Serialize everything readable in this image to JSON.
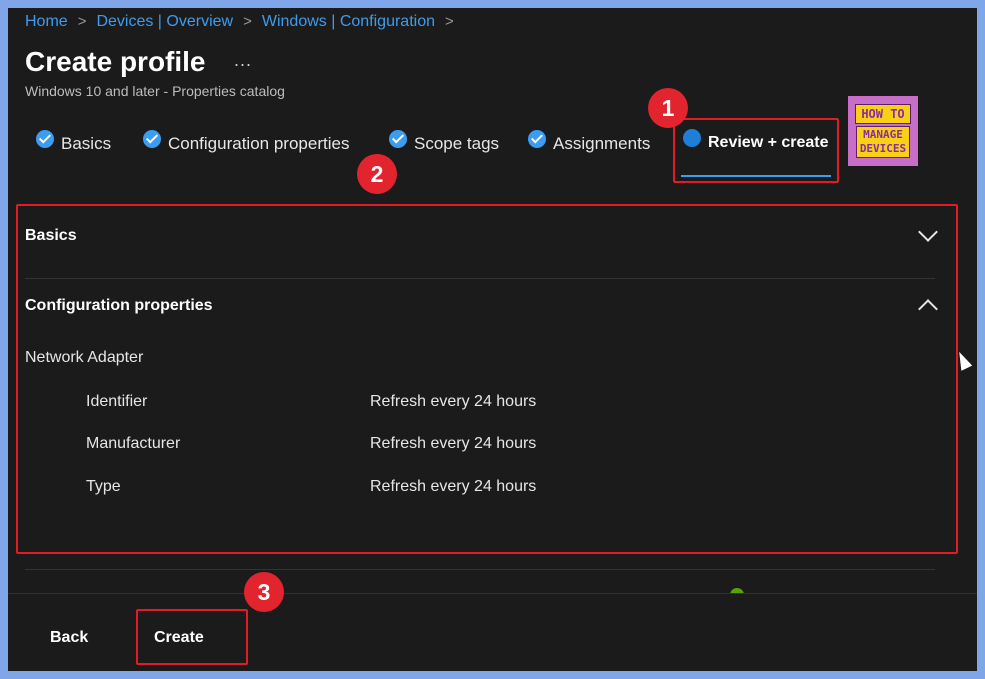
{
  "breadcrumb": [
    "Home",
    "Devices | Overview",
    "Windows | Configuration"
  ],
  "page": {
    "title": "Create profile",
    "more": "...",
    "subtitle": "Windows 10 and later - Properties catalog"
  },
  "tabs": [
    {
      "label": "Basics",
      "state": "complete"
    },
    {
      "label": "Configuration properties",
      "state": "complete"
    },
    {
      "label": "Scope tags",
      "state": "complete"
    },
    {
      "label": "Assignments",
      "state": "complete"
    },
    {
      "label": "Review + create",
      "state": "active"
    }
  ],
  "logo": {
    "line1": "HOW TO",
    "line2": "MANAGE",
    "line3": "DEVICES"
  },
  "annotations": {
    "badge1": "1",
    "badge2": "2",
    "badge3": "3"
  },
  "sections": {
    "basics": {
      "title": "Basics",
      "expanded": false
    },
    "configuration": {
      "title": "Configuration properties",
      "expanded": true,
      "group": "Network Adapter",
      "rows": [
        {
          "label": "Identifier",
          "value": "Refresh every 24 hours"
        },
        {
          "label": "Manufacturer",
          "value": "Refresh every 24 hours"
        },
        {
          "label": "Type",
          "value": "Refresh every 24 hours"
        }
      ]
    }
  },
  "footer": {
    "back": "Back",
    "create": "Create"
  },
  "colors": {
    "accent": "#3c9cf0",
    "annotation": "#e21b25",
    "background": "#1b1b1b"
  }
}
